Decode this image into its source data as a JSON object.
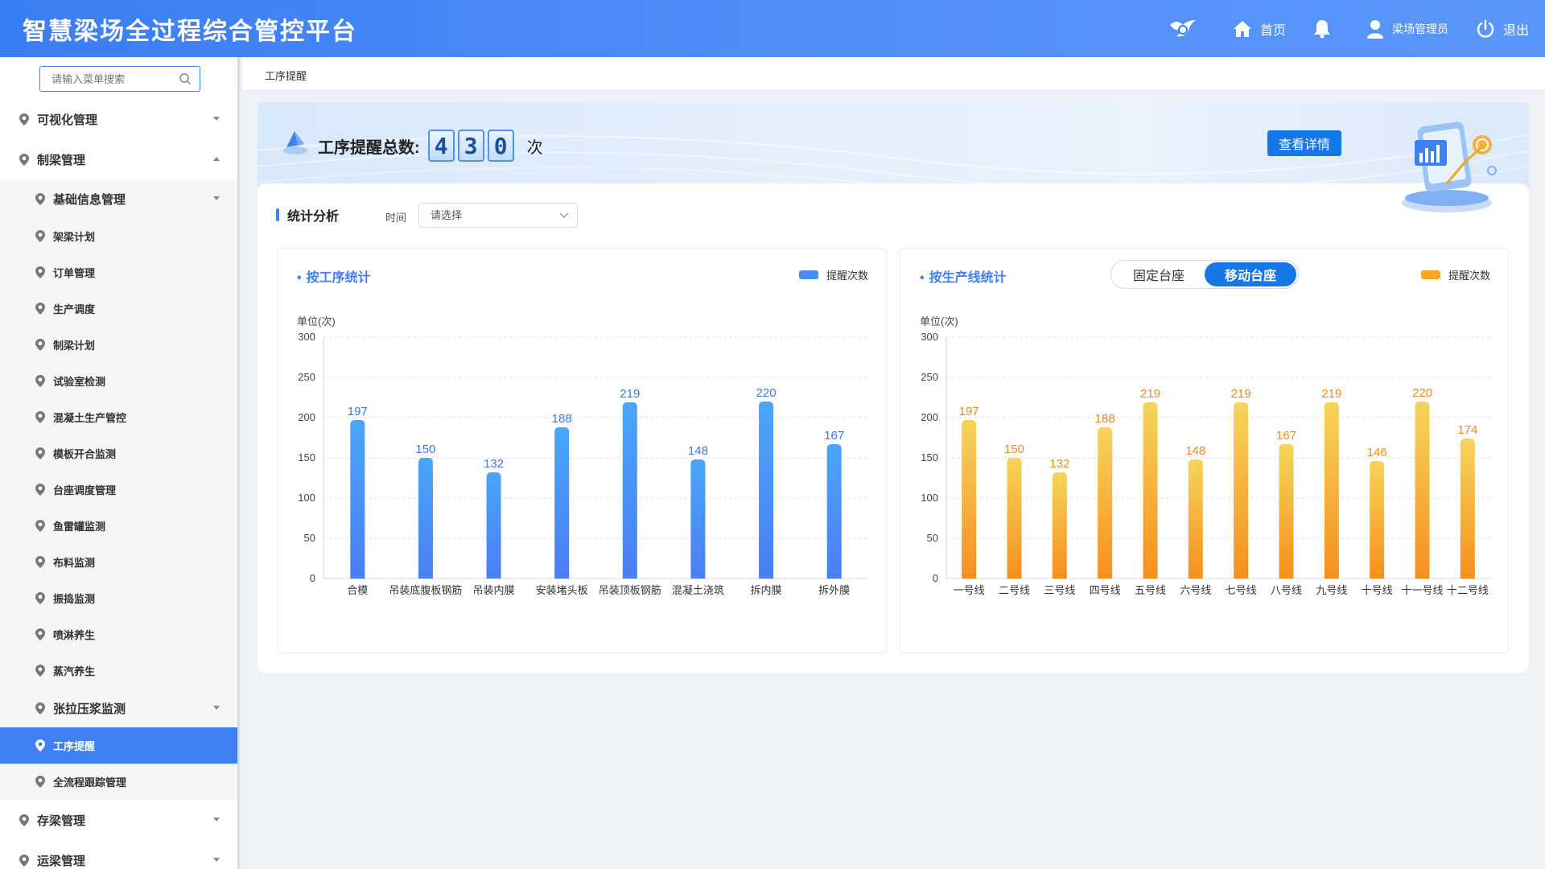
{
  "header": {
    "title": "智慧梁场全过程综合管控平台",
    "home_label": "首页",
    "user_label": "梁场管理员",
    "logout_label": "退出"
  },
  "sidebar": {
    "search_placeholder": "请输入菜单搜索",
    "items": [
      {
        "label": "可视化管理",
        "level": 1
      },
      {
        "label": "制梁管理",
        "level": 1
      },
      {
        "label": "基础信息管理",
        "level": 2
      },
      {
        "label": "架梁计划",
        "level": 2
      },
      {
        "label": "订单管理",
        "level": 2
      },
      {
        "label": "生产调度",
        "level": 2
      },
      {
        "label": "制梁计划",
        "level": 2
      },
      {
        "label": "试验室检测",
        "level": 2
      },
      {
        "label": "混凝土生产管控",
        "level": 2
      },
      {
        "label": "模板开合监测",
        "level": 2
      },
      {
        "label": "台座调度管理",
        "level": 2
      },
      {
        "label": "鱼雷罐监测",
        "level": 2
      },
      {
        "label": "布料监测",
        "level": 2
      },
      {
        "label": "振捣监测",
        "level": 2
      },
      {
        "label": "喷淋养生",
        "level": 2
      },
      {
        "label": "蒸汽养生",
        "level": 2
      },
      {
        "label": "张拉压浆监测",
        "level": 2
      },
      {
        "label": "工序提醒",
        "level": 2,
        "active": true
      },
      {
        "label": "全流程跟踪管理",
        "level": 2
      },
      {
        "label": "存梁管理",
        "level": 1
      },
      {
        "label": "运梁管理",
        "level": 1
      }
    ]
  },
  "breadcrumb": "工序提醒",
  "banner": {
    "title": "工序提醒总数:",
    "digits": [
      "4",
      "3",
      "0"
    ],
    "unit": "次",
    "detail_button": "查看详情"
  },
  "stats": {
    "title": "统计分析",
    "time_label": "时间",
    "time_placeholder": "请选择"
  },
  "left_panel": {
    "title": "按工序统计",
    "legend": "提醒次数",
    "color": "#4a8cf6"
  },
  "right_panel": {
    "title": "按生产线统计",
    "toggle_fixed": "固定台座",
    "toggle_mobile": "移动台座",
    "legend": "提醒次数",
    "color": "#f5a623"
  },
  "chart_data": [
    {
      "type": "bar",
      "title": "按工序统计",
      "ylabel": "单位(次)",
      "ylim": [
        0,
        300
      ],
      "yticks": [
        0,
        50,
        100,
        150,
        200,
        250,
        300
      ],
      "categories": [
        "合模",
        "吊装底腹板钢筋",
        "吊装内膜",
        "安装堵头板",
        "吊装顶板钢筋",
        "混凝土浇筑",
        "拆内膜",
        "拆外膜"
      ],
      "series": [
        {
          "name": "提醒次数",
          "values": [
            197,
            150,
            132,
            188,
            219,
            148,
            220,
            167
          ]
        }
      ]
    },
    {
      "type": "bar",
      "title": "按生产线统计",
      "ylabel": "单位(次)",
      "ylim": [
        0,
        300
      ],
      "yticks": [
        0,
        50,
        100,
        150,
        200,
        250,
        300
      ],
      "categories": [
        "一号线",
        "二号线",
        "三号线",
        "四号线",
        "五号线",
        "六号线",
        "七号线",
        "八号线",
        "九号线",
        "十号线",
        "十一号线",
        "十二号线"
      ],
      "series": [
        {
          "name": "提醒次数",
          "values": [
            197,
            150,
            132,
            188,
            219,
            148,
            219,
            167,
            219,
            146,
            220,
            174
          ]
        }
      ]
    }
  ]
}
